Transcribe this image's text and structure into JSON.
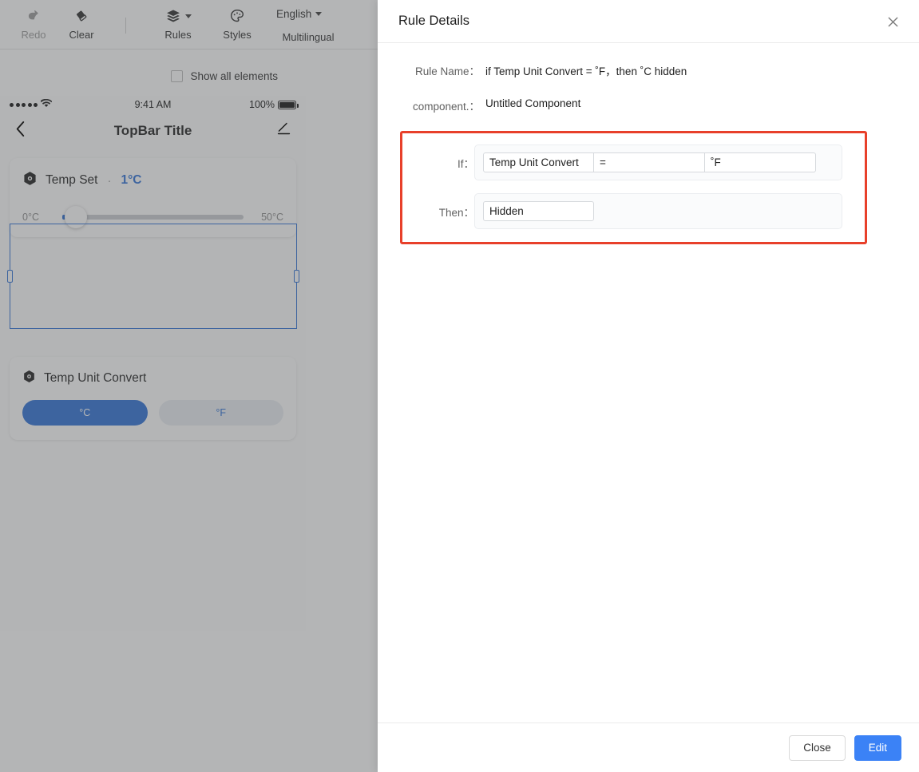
{
  "toolbar": {
    "items": [
      {
        "label": "Redo",
        "icon": "redo-icon",
        "disabled": true
      },
      {
        "label": "Clear",
        "icon": "eraser-icon",
        "disabled": false
      },
      {
        "label": "Rules",
        "icon": "layers-icon",
        "disabled": false
      },
      {
        "label": "Styles",
        "icon": "palette-icon",
        "disabled": false
      }
    ],
    "language_value": "English",
    "multilingual_label": "Multilingual"
  },
  "canvas": {
    "show_all_elements_label": "Show all elements",
    "show_all_elements_checked": false,
    "status_bar": {
      "time": "9:41 AM",
      "battery_percent": "100%"
    },
    "topbar": {
      "title": "TopBar Title",
      "back_icon": "chevron-left-icon",
      "edit_icon": "pencil-icon"
    },
    "cards": [
      {
        "icon": "hexagon-icon",
        "title": "Temp Set",
        "separator": "·",
        "value": "1°C",
        "slider": {
          "min_label": "0°C",
          "max_label": "50°C",
          "percent": 2
        },
        "selected": true
      },
      {
        "icon": "hexagon-icon",
        "title": "Temp Unit Convert",
        "options": [
          {
            "label": "°C",
            "selected": true
          },
          {
            "label": "°F",
            "selected": false
          }
        ]
      }
    ]
  },
  "modal": {
    "title": "Rule Details",
    "close_icon": "close-icon",
    "fields": [
      {
        "label": "Rule Name：",
        "value": "if Temp Unit Convert = ˚F，then ˚C hidden"
      },
      {
        "label": "component.：",
        "value": "Untitled Component"
      }
    ],
    "rule": {
      "if_label": "If：",
      "if_segments": [
        "Temp Unit Convert",
        "=",
        "˚F"
      ],
      "then_label": "Then：",
      "then_segments": [
        "Hidden"
      ],
      "highlight_color": "#e8402a"
    },
    "footer": {
      "close_label": "Close",
      "edit_label": "Edit",
      "primary_color": "#3b82f6"
    }
  }
}
